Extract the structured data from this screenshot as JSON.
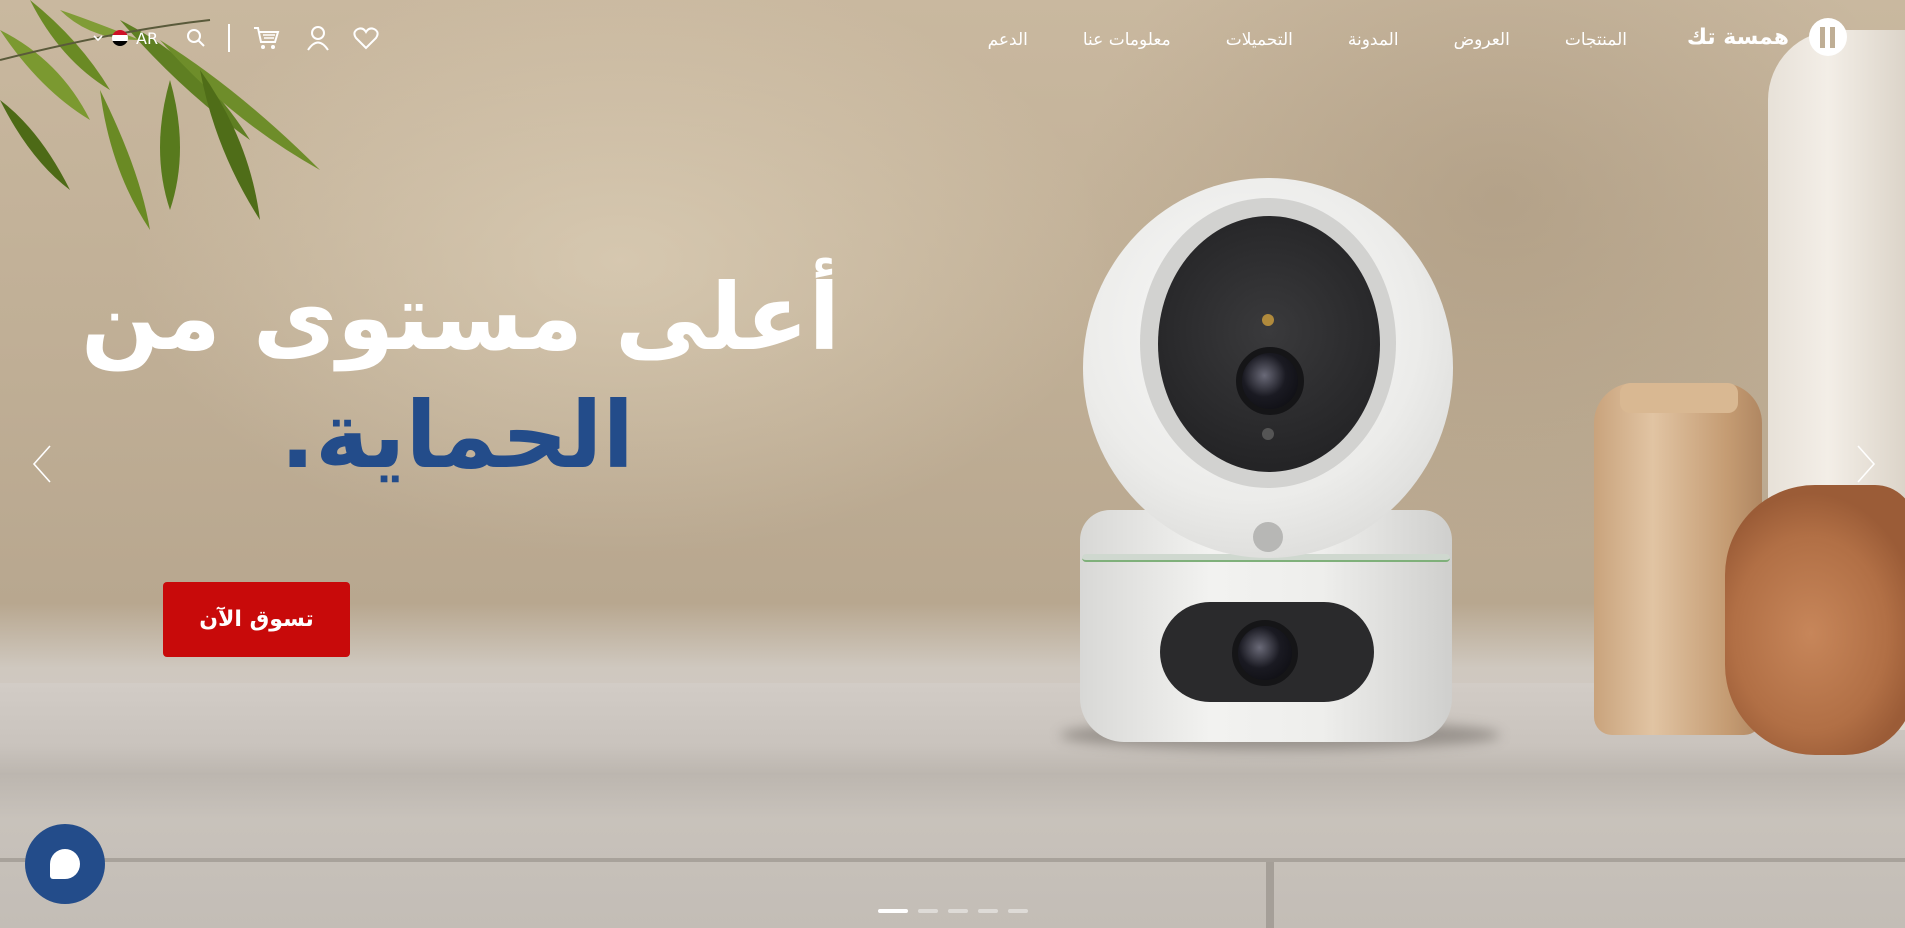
{
  "brand": {
    "name": "همسة تك",
    "logo_icon": "brand-h-logo-icon"
  },
  "nav": {
    "items": [
      {
        "label": "المنتجات"
      },
      {
        "label": "العروض"
      },
      {
        "label": "المدونة"
      },
      {
        "label": "التحميلات"
      },
      {
        "label": "معلومات عنا"
      },
      {
        "label": "الدعم"
      }
    ]
  },
  "tools": {
    "language": "AR",
    "icons": [
      "wishlist-heart-icon",
      "user-icon",
      "cart-icon",
      "search-icon",
      "egypt-flag-icon",
      "chevron-down-icon"
    ]
  },
  "hero": {
    "headline_line1": "أعلى مستوى من",
    "headline_line2": "الحماية.",
    "cta_label": "تسوق الآن",
    "slides_count": 5,
    "active_slide": 1
  },
  "colors": {
    "accent_blue": "#234c8a",
    "cta_red": "#c80a0a",
    "text_white": "#ffffff"
  }
}
